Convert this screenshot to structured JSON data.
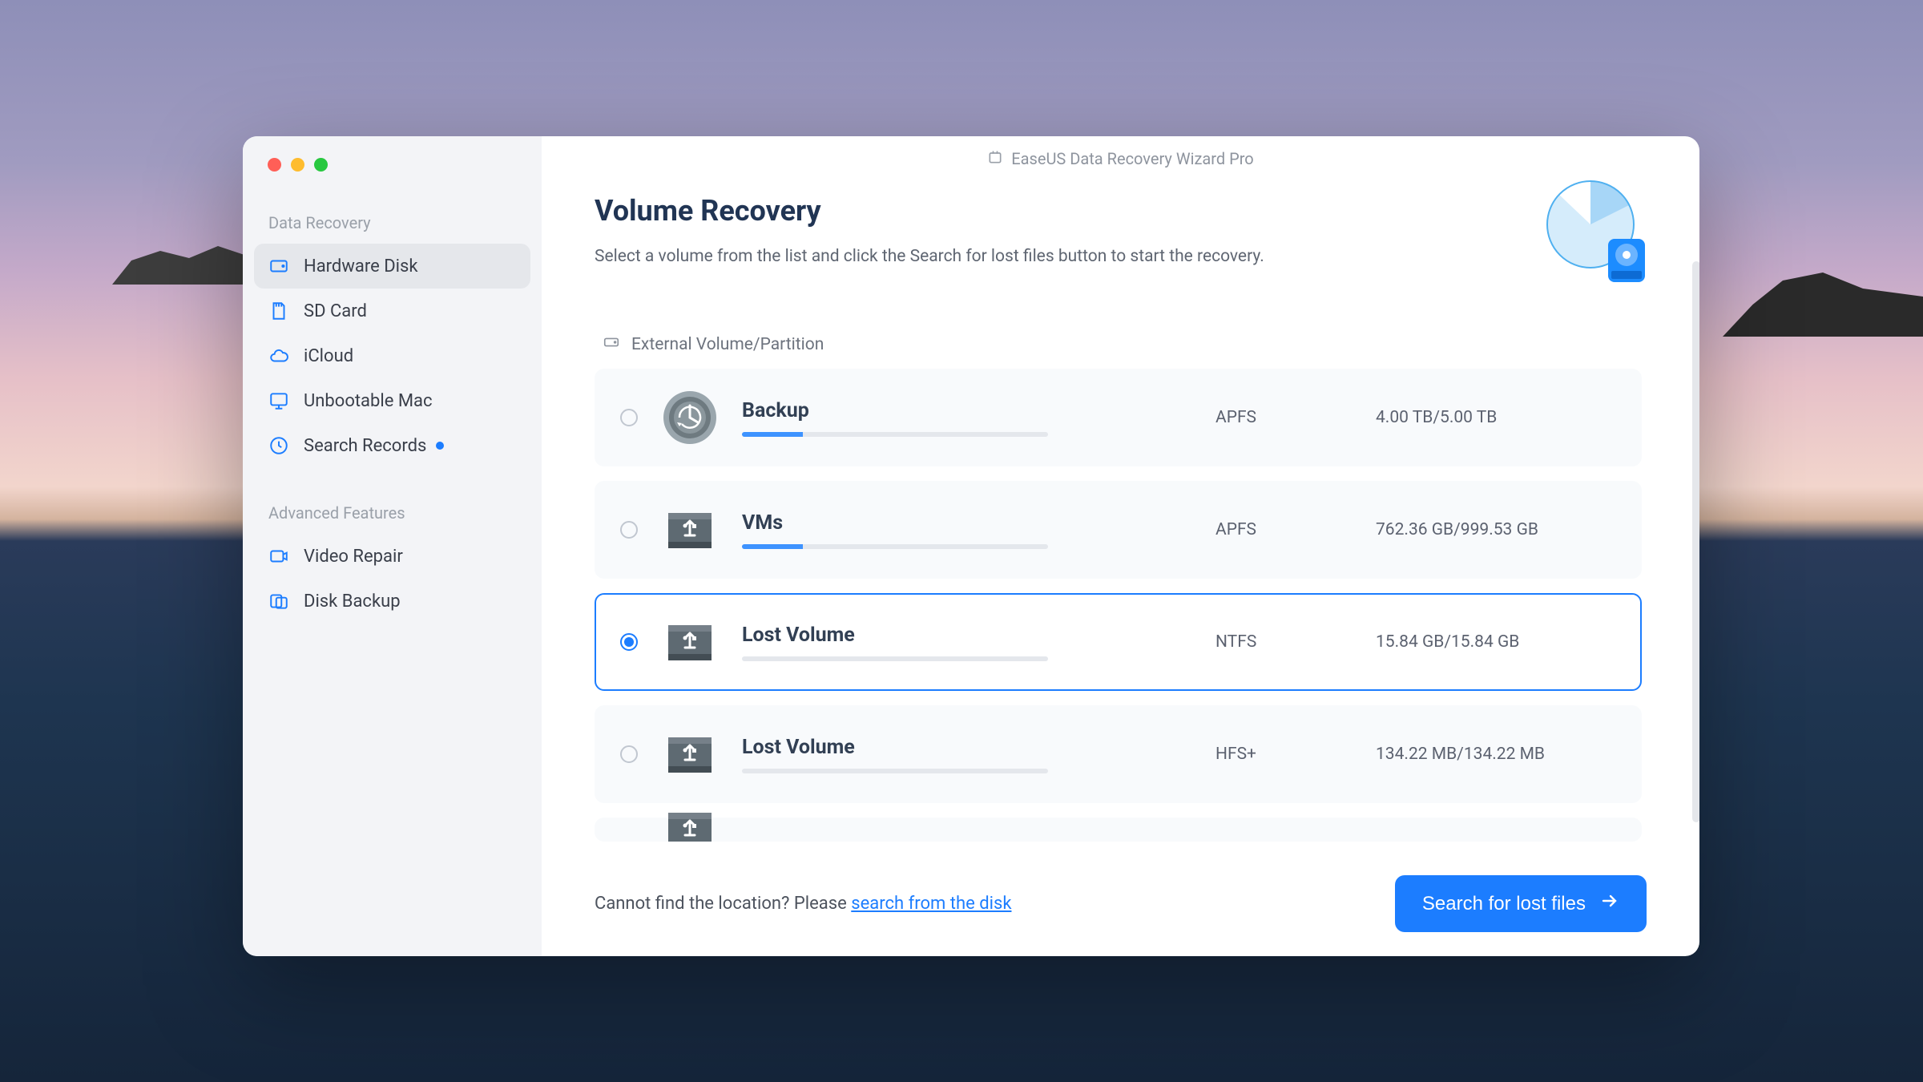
{
  "titlebar_text": "EaseUS Data Recovery Wizard  Pro",
  "sidebar": {
    "section1": "Data Recovery",
    "section2": "Advanced Features",
    "items": [
      {
        "label": "Hardware Disk"
      },
      {
        "label": "SD Card"
      },
      {
        "label": "iCloud"
      },
      {
        "label": "Unbootable Mac"
      },
      {
        "label": "Search Records"
      }
    ],
    "advanced": [
      {
        "label": "Video Repair"
      },
      {
        "label": "Disk Backup"
      }
    ]
  },
  "page": {
    "title": "Volume Recovery",
    "subtitle": "Select a volume from the list and click the Search for lost files button to start the recovery.",
    "section_label": "External Volume/Partition"
  },
  "volumes": [
    {
      "name": "Backup",
      "fs": "APFS",
      "size": "4.00 TB/5.00 TB",
      "used_pct": 20,
      "selected": false,
      "icon": "timemachine"
    },
    {
      "name": "VMs",
      "fs": "APFS",
      "size": "762.36 GB/999.53 GB",
      "used_pct": 20,
      "selected": false,
      "icon": "usb"
    },
    {
      "name": "Lost Volume",
      "fs": "NTFS",
      "size": "15.84 GB/15.84 GB",
      "used_pct": 0,
      "selected": true,
      "icon": "usb"
    },
    {
      "name": "Lost Volume",
      "fs": "HFS+",
      "size": "134.22 MB/134.22 MB",
      "used_pct": 0,
      "selected": false,
      "icon": "usb"
    }
  ],
  "footer": {
    "prefix": "Cannot find the location? Please ",
    "link": "search from the disk",
    "button": "Search for lost files"
  },
  "colors": {
    "accent": "#1c7dff"
  }
}
